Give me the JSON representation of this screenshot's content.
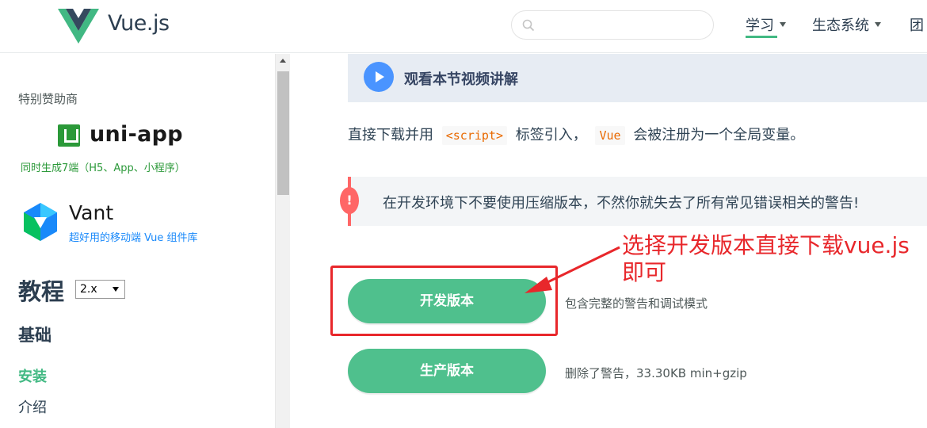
{
  "header": {
    "brand": "Vue.js",
    "search_placeholder": "",
    "nav": [
      {
        "label": "学习",
        "active": true
      },
      {
        "label": "生态系统"
      },
      {
        "label": "团"
      }
    ]
  },
  "sidebar": {
    "sponsor_title": "特别赞助商",
    "sponsors": [
      {
        "name": "uni-app",
        "subtitle": "同时生成7端（H5、App、小程序）"
      },
      {
        "name": "Vant",
        "subtitle": "超好用的移动端 Vue 组件库"
      }
    ],
    "menu_title": "教程",
    "version": "2.x",
    "section_title": "基础",
    "items": [
      {
        "label": "安装",
        "active": true
      },
      {
        "label": "介绍"
      }
    ]
  },
  "content": {
    "video_label": "观看本节视频讲解",
    "paragraph": {
      "pre": "直接下载并用",
      "code1": "<script>",
      "mid": "标签引入，",
      "code2": "Vue",
      "post": "会被注册为一个全局变量。"
    },
    "warning_badge": "!",
    "warning": "在开发环境下不要使用压缩版本，不然你就失去了所有常见错误相关的警告!",
    "downloads": [
      {
        "label": "开发版本",
        "description": "包含完整的警告和调试模式"
      },
      {
        "label": "生产版本",
        "description": "删除了警告，33.30KB min+gzip"
      }
    ]
  },
  "annotation": {
    "text": "选择开发版本直接下载vue.js即可",
    "color": "#e8272b"
  },
  "colors": {
    "accent": "#42b983",
    "button": "#4fc08d",
    "warning": "#ff6666",
    "play": "#4a94ff"
  }
}
